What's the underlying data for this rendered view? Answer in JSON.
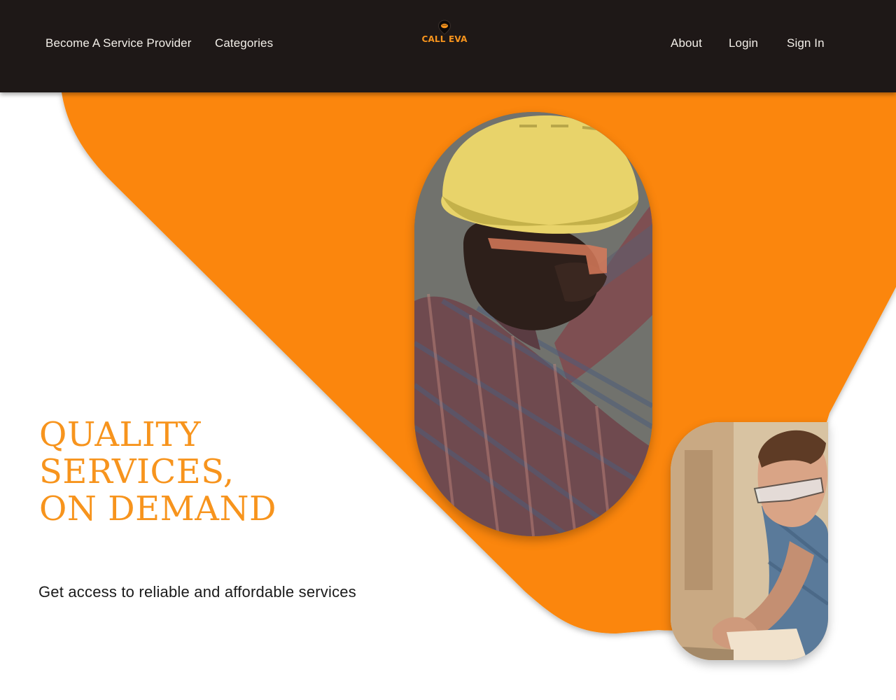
{
  "header": {
    "nav_left": [
      "Become A Service Provider",
      "Categories"
    ],
    "nav_right": [
      "About",
      "Login",
      "Sign In"
    ],
    "logo_text": "CALL EVA",
    "logo_icon": "location-pin-icon"
  },
  "hero": {
    "headline_lines": [
      "QUALITY",
      "SERVICES,",
      "ON DEMAND"
    ],
    "subtitle": "Get access to reliable and affordable services"
  },
  "images": {
    "worker": "construction-worker-hard-hat-photo",
    "carpenter": "carpenter-safety-glasses-photo"
  },
  "colors": {
    "header_bg": "#1e1817",
    "accent": "#f7941d",
    "hero_shape": "#fb8607",
    "text_dark": "#1a1a1a",
    "nav_text": "#f3efe9"
  }
}
